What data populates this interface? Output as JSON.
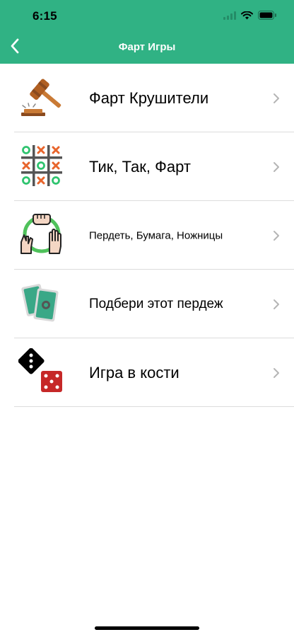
{
  "status_bar": {
    "time": "6:15"
  },
  "nav": {
    "title": "Фарт Игры",
    "back_icon": "chevron-left-icon"
  },
  "games": [
    {
      "label": "Фарт Крушители",
      "icon": "gavel-icon"
    },
    {
      "label": "Тик, Так, Фарт",
      "icon": "tic-tac-toe-icon"
    },
    {
      "label": "Пердеть, Бумага, Ножницы",
      "icon": "rock-paper-scissors-icon"
    },
    {
      "label": "Подбери этот пердеж",
      "icon": "cards-icon"
    },
    {
      "label": "Игра в кости",
      "icon": "dice-icon"
    }
  ],
  "colors": {
    "header": "#30b284",
    "chevron": "#b5b5b5",
    "separator": "#dcdcdc"
  }
}
